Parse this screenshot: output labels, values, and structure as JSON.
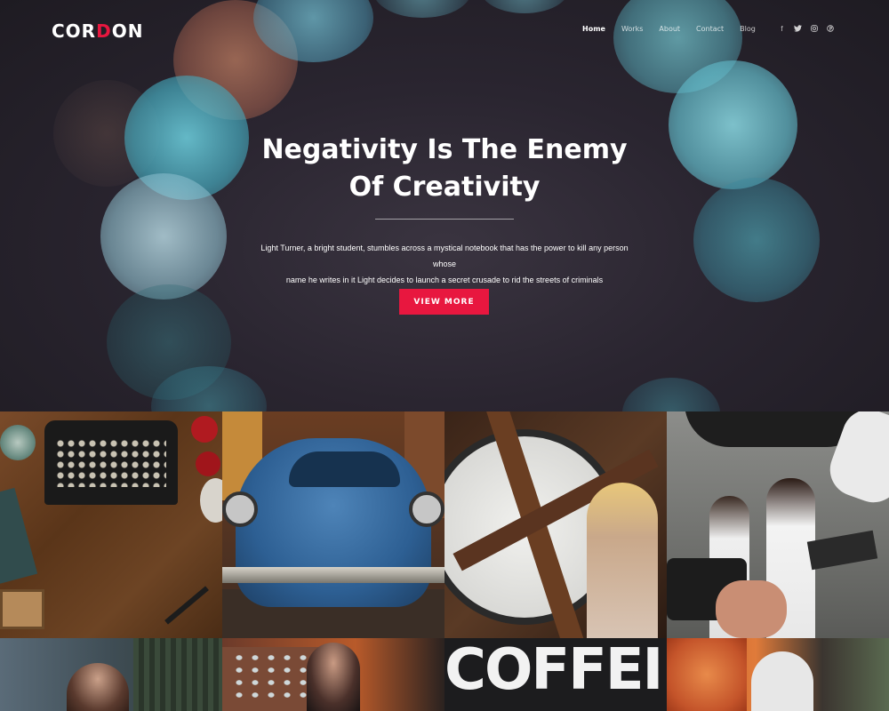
{
  "header": {
    "logo": {
      "part1": "COR",
      "accent": "D",
      "part2": "ON"
    },
    "nav": [
      {
        "label": "Home",
        "active": true
      },
      {
        "label": "Works"
      },
      {
        "label": "About"
      },
      {
        "label": "Contact"
      },
      {
        "label": "Blog"
      }
    ],
    "social": [
      {
        "icon": "facebook-icon",
        "glyph": "f"
      },
      {
        "icon": "twitter-icon",
        "glyph": "t"
      },
      {
        "icon": "instagram-icon",
        "glyph": "◎"
      },
      {
        "icon": "pinterest-icon",
        "glyph": "℗"
      }
    ]
  },
  "hero": {
    "title_line1": "Negativity Is The Enemy",
    "title_line2": "Of Creativity",
    "text_line1": "Light Turner, a bright student, stumbles across a mystical notebook that has the power to kill any person whose",
    "text_line2": "name he writes in it Light decides to launch a secret crusade to rid the streets of criminals",
    "button": "VIEW MORE"
  },
  "gallery": {
    "tile7_text": "COFFEI"
  },
  "colors": {
    "accent": "#e8173f",
    "hero_bg": "#2a2530"
  }
}
